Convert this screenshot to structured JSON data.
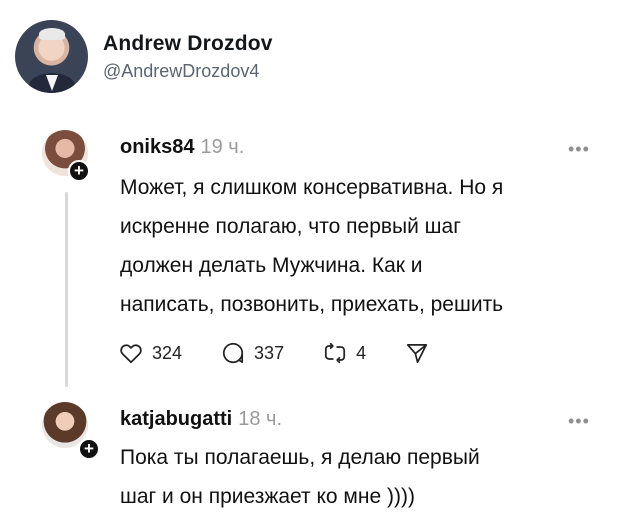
{
  "author": {
    "name": "Andrew Drozdov",
    "handle": "@AndrewDrozdov4"
  },
  "posts": [
    {
      "username": "oniks84",
      "time": "19 ч.",
      "text": "Может, я слишком консервативна. Но я\nискренне полагаю, что первый шаг\nдолжен делать Мужчина. Как и\nнаписать, позвонить, приехать, решить",
      "likes": "324",
      "replies": "337",
      "reposts": "4",
      "more_icon": "ellipsis-icon"
    },
    {
      "username": "katjabugatti",
      "time": "18 ч.",
      "text": "Пока ты полагаешь, я делаю первый\nшаг и он приезжает ко мне ))))",
      "more_icon": "ellipsis-icon"
    }
  ],
  "colors": {
    "text": "#111111",
    "muted": "#9a9a9a",
    "handle": "#5b6470",
    "thread_line": "#d9d9d9"
  }
}
